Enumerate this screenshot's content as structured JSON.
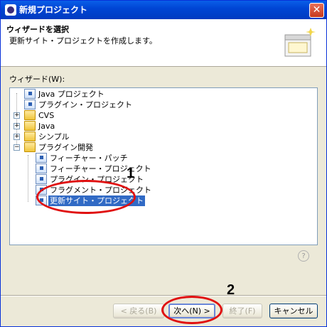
{
  "window": {
    "title": "新規プロジェクト",
    "close_glyph": "✕"
  },
  "header": {
    "title": "ウィザードを選択",
    "description": "更新サイト・プロジェクトを作成します。"
  },
  "tree": {
    "label": "ウィザード(W):",
    "items": [
      {
        "label": "Java プロジェクト",
        "icon": "java-project-icon"
      },
      {
        "label": "プラグイン・プロジェクト",
        "icon": "plugin-project-icon"
      },
      {
        "label": "CVS",
        "icon": "folder-icon",
        "expander": "+"
      },
      {
        "label": "Java",
        "icon": "folder-icon",
        "expander": "+"
      },
      {
        "label": "シンプル",
        "icon": "folder-icon",
        "expander": "+"
      },
      {
        "label": "プラグイン開発",
        "icon": "folder-open-icon",
        "expander": "−"
      },
      {
        "label": "フィーチャー・パッチ",
        "icon": "feature-patch-icon"
      },
      {
        "label": "フィーチャー・プロジェクト",
        "icon": "feature-project-icon"
      },
      {
        "label": "プラグイン・プロジェクト",
        "icon": "plugin-project-icon"
      },
      {
        "label": "フラグメント・プロジェクト",
        "icon": "fragment-project-icon"
      },
      {
        "label": "更新サイト・プロジェクト",
        "icon": "update-site-icon",
        "selected": true
      }
    ]
  },
  "help_glyph": "?",
  "buttons": {
    "back": "< 戻る(B)",
    "next": "次へ(N) >",
    "finish": "終了(F)",
    "cancel": "キャンセル"
  },
  "annotations": {
    "one": "1",
    "two": "2",
    "color": "#e01010"
  }
}
